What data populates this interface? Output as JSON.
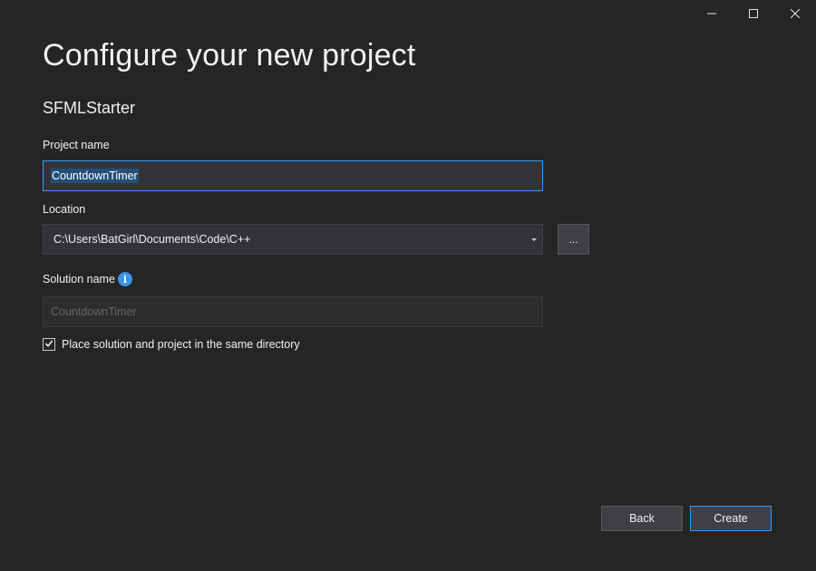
{
  "window": {
    "controls": {
      "minimize_icon": "minimize-icon",
      "maximize_icon": "maximize-icon",
      "close_icon": "close-icon"
    }
  },
  "header": {
    "title": "Configure your new project",
    "template_name": "SFMLStarter"
  },
  "form": {
    "project_name": {
      "label": "Project name",
      "value": "CountdownTimer"
    },
    "location": {
      "label": "Location",
      "value": "C:\\Users\\BatGirl\\Documents\\Code\\C++",
      "browse_label": "..."
    },
    "solution_name": {
      "label": "Solution name",
      "info_glyph": "i",
      "placeholder": "CountdownTimer"
    },
    "same_directory": {
      "label": "Place solution and project in the same directory",
      "checked": true
    }
  },
  "footer": {
    "back_label": "Back",
    "create_label": "Create"
  },
  "colors": {
    "background": "#252526",
    "accent": "#3399ff",
    "selection": "#264f78",
    "info": "#3794e6"
  }
}
